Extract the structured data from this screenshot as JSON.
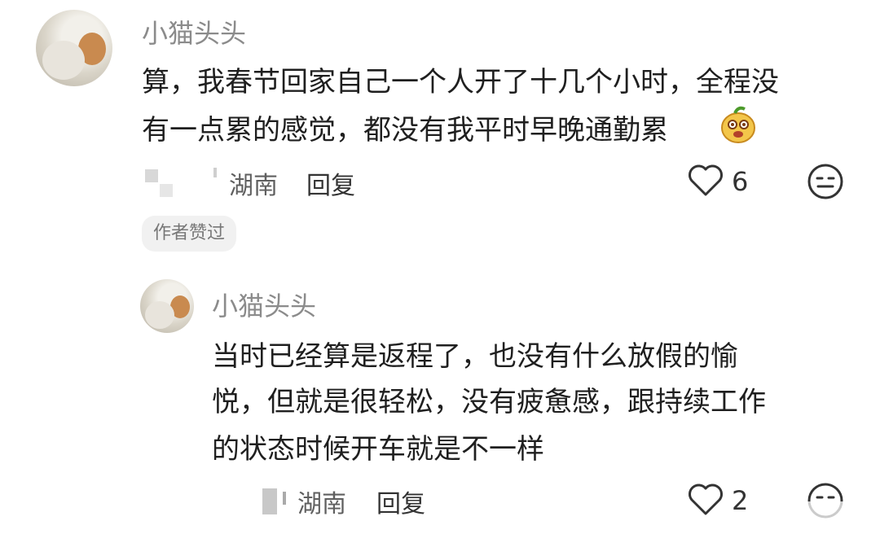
{
  "comments": [
    {
      "username": "小猫头头",
      "text_line1": "算，我春节回家自己一个人开了十几个小时，全程没",
      "text_line2": "有一点累的感觉，都没有我平时早晚通勤累",
      "location": "湖南",
      "reply_label": "回复",
      "like_count": "6",
      "badge": "作者赞过"
    },
    {
      "username": "小猫头头",
      "text_line1": "当时已经算是返程了，也没有什么放假的愉",
      "text_line2": "悦，但就是很轻松，没有疲惫感，跟持续工作",
      "text_line3": "的状态时候开车就是不一样",
      "location": "湖南",
      "reply_label": "回复",
      "like_count": "2"
    }
  ],
  "colors": {
    "username": "#8b8b8b",
    "text": "#1f1f1f",
    "badge_bg": "#f1f1f1"
  },
  "icons": [
    "cat-avatar",
    "emoji-sticker",
    "heart-icon",
    "neutral-face-icon"
  ]
}
